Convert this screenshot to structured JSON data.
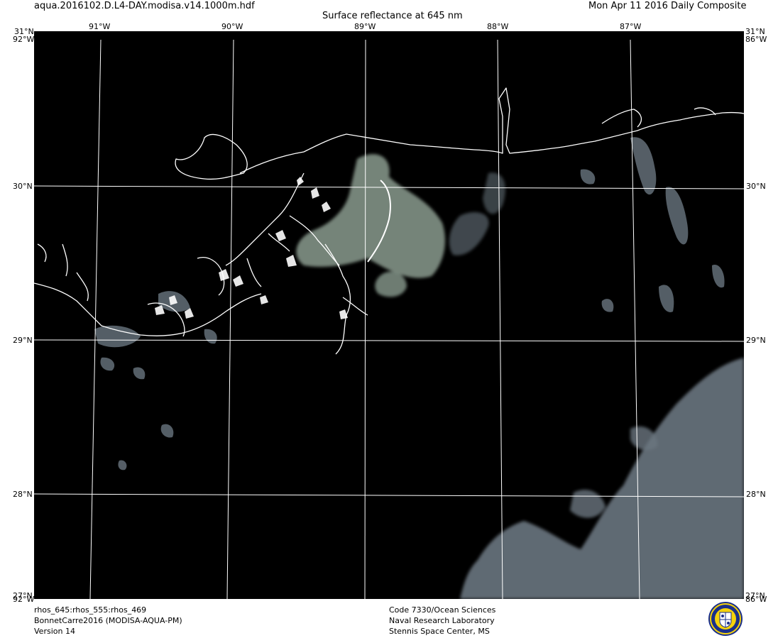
{
  "header": {
    "filename": "aqua.2016102.D.L4-DAY.modisa.v14.1000m.hdf",
    "title": "Surface reflectance at 645 nm",
    "composite": "Mon Apr 11 2016 Daily Composite"
  },
  "map": {
    "lon_labels_top": [
      "91°W",
      "90°W",
      "89°W",
      "88°W",
      "87°W"
    ],
    "lat_labels": [
      "30°N",
      "29°N",
      "28°N"
    ],
    "corner_top_left": "31°N",
    "corner_top_right": "31°N",
    "corner_bottom_left": "27°N",
    "corner_bottom_right": "27°N",
    "corner_stack_top": "92°W",
    "corner_stack_bottom": "86°W",
    "background_color": "#000000",
    "coast_color": "#ffffff",
    "grid_color": "#ffffff",
    "cloud_color": "#6a7680",
    "sediment_color": "#8a9b8e"
  },
  "footer": {
    "left": [
      "rhos_645:rhos_555:rhos_469",
      "BonnetCarre2016 (MODISA-AQUA-PM)",
      "Version 14"
    ],
    "center": [
      "Code 7330/Ocean Sciences",
      "Naval Research Laboratory",
      "Stennis Space Center, MS"
    ],
    "logo": "NRL seal"
  }
}
